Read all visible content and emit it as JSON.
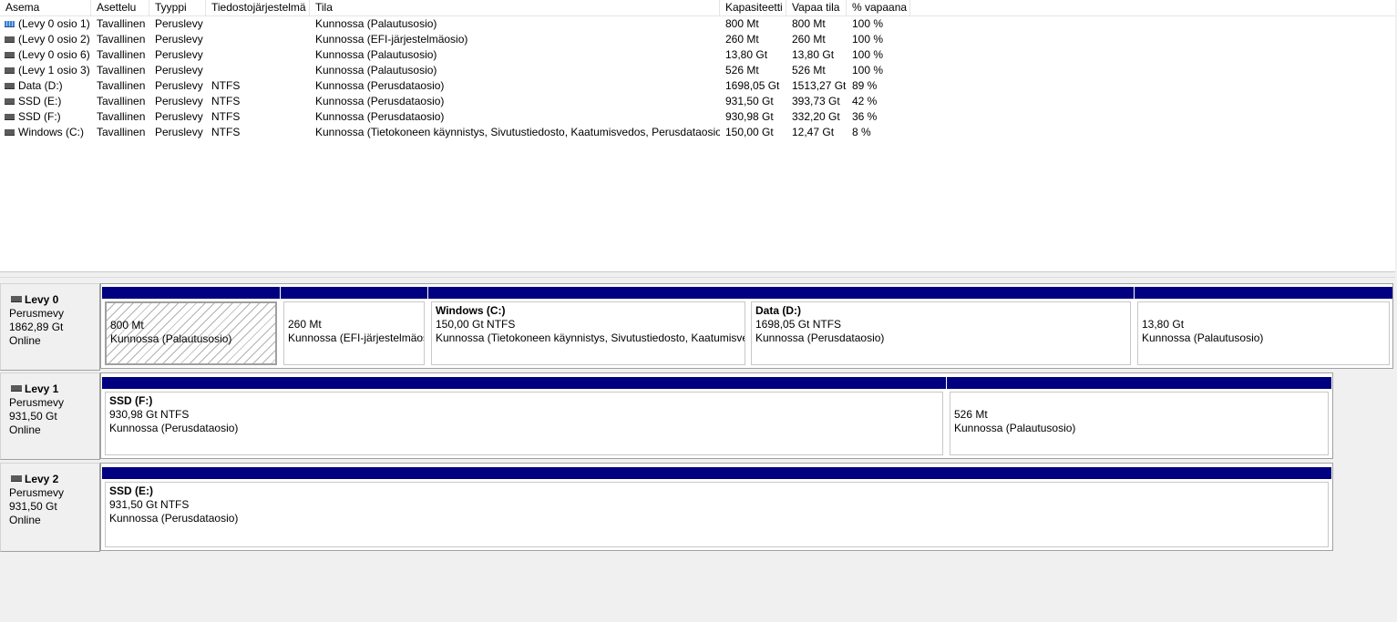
{
  "volume_list": {
    "columns": [
      "Asema",
      "Asettelu",
      "Tyyppi",
      "Tiedostojärjestelmä",
      "Tila",
      "Kapasiteetti",
      "Vapaa tila",
      "% vapaana"
    ],
    "rows": [
      {
        "name": "(Levy 0 osio 1)",
        "layout": "Tavallinen",
        "type": "Peruslevy",
        "fs": "",
        "status": "Kunnossa (Palautusosio)",
        "capacity": "800 Mt",
        "free": "800 Mt",
        "pct": "100 %",
        "icon": "recovery-volume-icon"
      },
      {
        "name": "(Levy 0 osio 2)",
        "layout": "Tavallinen",
        "type": "Peruslevy",
        "fs": "",
        "status": "Kunnossa (EFI-järjestelmäosio)",
        "capacity": "260 Mt",
        "free": "260 Mt",
        "pct": "100 %",
        "icon": "volume-icon"
      },
      {
        "name": "(Levy 0 osio 6)",
        "layout": "Tavallinen",
        "type": "Peruslevy",
        "fs": "",
        "status": "Kunnossa (Palautusosio)",
        "capacity": "13,80 Gt",
        "free": "13,80 Gt",
        "pct": "100 %",
        "icon": "volume-icon"
      },
      {
        "name": "(Levy 1 osio 3)",
        "layout": "Tavallinen",
        "type": "Peruslevy",
        "fs": "",
        "status": "Kunnossa (Palautusosio)",
        "capacity": "526 Mt",
        "free": "526 Mt",
        "pct": "100 %",
        "icon": "volume-icon"
      },
      {
        "name": "Data (D:)",
        "layout": "Tavallinen",
        "type": "Peruslevy",
        "fs": "NTFS",
        "status": "Kunnossa (Perusdataosio)",
        "capacity": "1698,05 Gt",
        "free": "1513,27 Gt",
        "pct": "89 %",
        "icon": "volume-icon"
      },
      {
        "name": "SSD (E:)",
        "layout": "Tavallinen",
        "type": "Peruslevy",
        "fs": "NTFS",
        "status": "Kunnossa (Perusdataosio)",
        "capacity": "931,50 Gt",
        "free": "393,73 Gt",
        "pct": "42 %",
        "icon": "volume-icon"
      },
      {
        "name": "SSD (F:)",
        "layout": "Tavallinen",
        "type": "Peruslevy",
        "fs": "NTFS",
        "status": "Kunnossa (Perusdataosio)",
        "capacity": "930,98 Gt",
        "free": "332,20 Gt",
        "pct": "36 %",
        "icon": "volume-icon"
      },
      {
        "name": "Windows (C:)",
        "layout": "Tavallinen",
        "type": "Peruslevy",
        "fs": "NTFS",
        "status": "Kunnossa (Tietokoneen käynnistys, Sivutustiedosto, Kaatumisvedos, Perusdataosio)",
        "capacity": "150,00 Gt",
        "free": "12,47 Gt",
        "pct": "8 %",
        "icon": "volume-icon"
      }
    ]
  },
  "disks": [
    {
      "title": "Levy 0",
      "type": "Perusmevy",
      "size": "1862,89 Gt",
      "state": "Online",
      "partitions": [
        {
          "name": "",
          "size": "800 Mt",
          "status": "Kunnossa (Palautusosio)"
        },
        {
          "name": "",
          "size": "260 Mt",
          "status": "Kunnossa (EFI-järjestelmäos"
        },
        {
          "name": "Windows  (C:)",
          "size": "150,00 Gt NTFS",
          "status": "Kunnossa (Tietokoneen käynnistys, Sivutustiedosto, Kaatumisve"
        },
        {
          "name": "Data  (D:)",
          "size": "1698,05 Gt NTFS",
          "status": "Kunnossa (Perusdataosio)"
        },
        {
          "name": "",
          "size": "13,80 Gt",
          "status": "Kunnossa (Palautusosio)"
        }
      ]
    },
    {
      "title": "Levy 1",
      "type": "Perusmevy",
      "size": "931,50 Gt",
      "state": "Online",
      "partitions": [
        {
          "name": "SSD  (F:)",
          "size": "930,98 Gt NTFS",
          "status": "Kunnossa (Perusdataosio)"
        },
        {
          "name": "",
          "size": "526 Mt",
          "status": "Kunnossa (Palautusosio)"
        }
      ]
    },
    {
      "title": "Levy 2",
      "type": "Perusmevy",
      "size": "931,50 Gt",
      "state": "Online",
      "partitions": [
        {
          "name": "SSD  (E:)",
          "size": "931,50 Gt NTFS",
          "status": "Kunnossa (Perusdataosio)"
        }
      ]
    }
  ],
  "colors": {
    "partition_bar": "#000080",
    "background": "#f0f0f0"
  }
}
